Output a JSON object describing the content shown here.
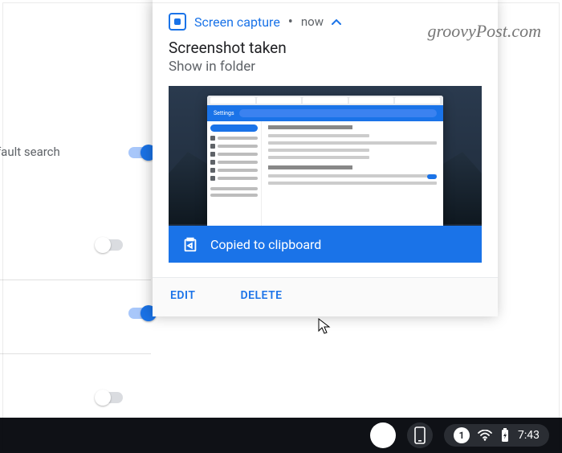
{
  "watermark": "groovyPost.com",
  "left": {
    "row_label": "efault search"
  },
  "notification": {
    "app_name": "Screen capture",
    "time": "now",
    "title": "Screenshot taken",
    "subtitle": "Show in folder",
    "banner_text": "Copied to clipboard",
    "preview_app_title": "Settings"
  },
  "actions": {
    "edit": "EDIT",
    "delete": "DELETE"
  },
  "taskbar": {
    "notification_count": "1",
    "clock": "7:43"
  }
}
